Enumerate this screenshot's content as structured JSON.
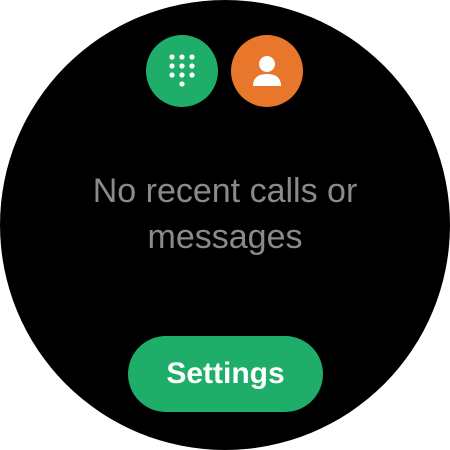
{
  "colors": {
    "screen_background": "#000000",
    "dialpad_button": "#1fae6a",
    "contacts_button": "#e8762b",
    "settings_button": "#1fae6a",
    "message_text": "#8a8a8a",
    "icon_color": "#ffffff"
  },
  "actions": {
    "dialpad": {
      "icon": "dialpad-icon"
    },
    "contacts": {
      "icon": "contact-person-icon"
    }
  },
  "main": {
    "empty_message": "No recent calls or messages"
  },
  "footer": {
    "settings_label": "Settings"
  }
}
